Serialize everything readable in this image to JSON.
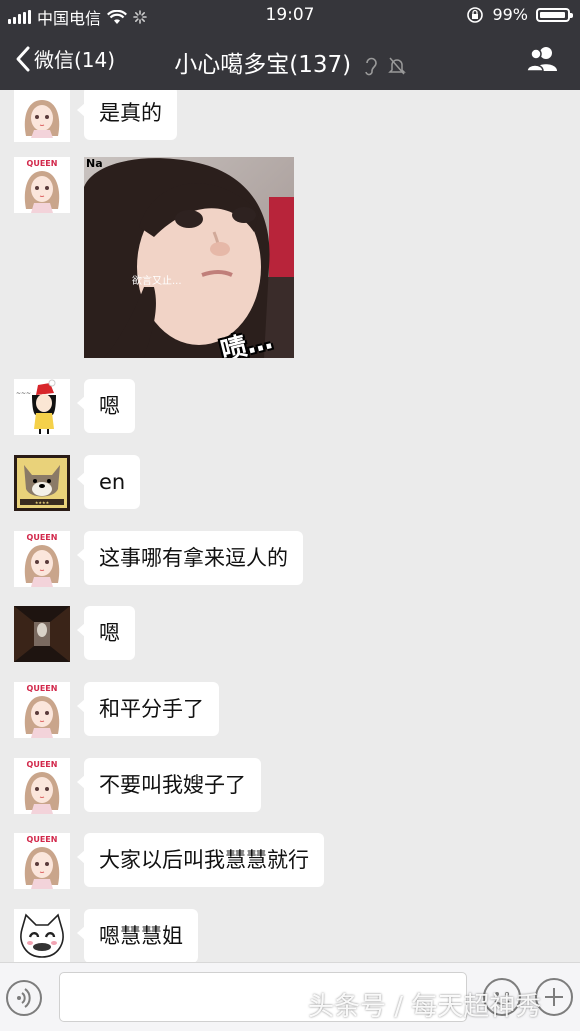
{
  "status_bar": {
    "carrier": "中国电信",
    "time": "19:07",
    "battery_percent": "99%",
    "battery_level": 0.99
  },
  "nav": {
    "back_label": "微信(14)",
    "title": "小心噶多宝(137)",
    "icons": [
      "chevron-left-icon",
      "ear-icon",
      "mute-bell-icon",
      "people-icon"
    ]
  },
  "messages": [
    {
      "avatar": "queen-girl-avatar",
      "text": "是真的"
    },
    {
      "avatar": "queen-girl-avatar",
      "image": {
        "tag": "Na",
        "caption_small": "欲言又止...",
        "caption_big": "啧…"
      }
    },
    {
      "avatar": "cartoon-girl-avatar",
      "text": "嗯"
    },
    {
      "avatar": "dog-avatar",
      "text": "en"
    },
    {
      "avatar": "queen-girl-avatar",
      "text": "这事哪有拿来逗人的"
    },
    {
      "avatar": "dark-hallway-avatar",
      "text": "嗯"
    },
    {
      "avatar": "queen-girl-avatar",
      "text": "和平分手了"
    },
    {
      "avatar": "queen-girl-avatar",
      "text": "不要叫我嫂子了"
    },
    {
      "avatar": "queen-girl-avatar",
      "text": "大家以后叫我慧慧就行"
    },
    {
      "avatar": "cat-avatar",
      "text": "嗯慧慧姐"
    }
  ],
  "avatar_labels": {
    "queen": "QUEEN"
  },
  "input_bar": {
    "watermark": "头条号 / 每天超神秀"
  },
  "colors": {
    "header_bg": "#36363b",
    "chat_bg": "#ebebeb",
    "bubble_bg": "#ffffff"
  }
}
